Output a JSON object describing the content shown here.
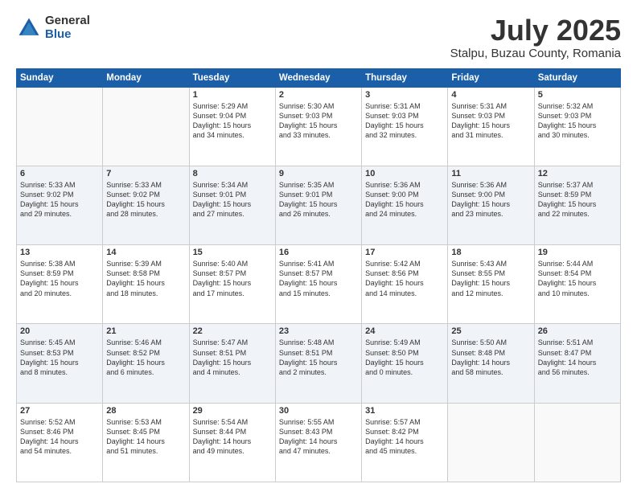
{
  "logo": {
    "general": "General",
    "blue": "Blue"
  },
  "title": "July 2025",
  "location": "Stalpu, Buzau County, Romania",
  "weekdays": [
    "Sunday",
    "Monday",
    "Tuesday",
    "Wednesday",
    "Thursday",
    "Friday",
    "Saturday"
  ],
  "weeks": [
    [
      {
        "day": "",
        "info": ""
      },
      {
        "day": "",
        "info": ""
      },
      {
        "day": "1",
        "info": "Sunrise: 5:29 AM\nSunset: 9:04 PM\nDaylight: 15 hours\nand 34 minutes."
      },
      {
        "day": "2",
        "info": "Sunrise: 5:30 AM\nSunset: 9:03 PM\nDaylight: 15 hours\nand 33 minutes."
      },
      {
        "day": "3",
        "info": "Sunrise: 5:31 AM\nSunset: 9:03 PM\nDaylight: 15 hours\nand 32 minutes."
      },
      {
        "day": "4",
        "info": "Sunrise: 5:31 AM\nSunset: 9:03 PM\nDaylight: 15 hours\nand 31 minutes."
      },
      {
        "day": "5",
        "info": "Sunrise: 5:32 AM\nSunset: 9:03 PM\nDaylight: 15 hours\nand 30 minutes."
      }
    ],
    [
      {
        "day": "6",
        "info": "Sunrise: 5:33 AM\nSunset: 9:02 PM\nDaylight: 15 hours\nand 29 minutes."
      },
      {
        "day": "7",
        "info": "Sunrise: 5:33 AM\nSunset: 9:02 PM\nDaylight: 15 hours\nand 28 minutes."
      },
      {
        "day": "8",
        "info": "Sunrise: 5:34 AM\nSunset: 9:01 PM\nDaylight: 15 hours\nand 27 minutes."
      },
      {
        "day": "9",
        "info": "Sunrise: 5:35 AM\nSunset: 9:01 PM\nDaylight: 15 hours\nand 26 minutes."
      },
      {
        "day": "10",
        "info": "Sunrise: 5:36 AM\nSunset: 9:00 PM\nDaylight: 15 hours\nand 24 minutes."
      },
      {
        "day": "11",
        "info": "Sunrise: 5:36 AM\nSunset: 9:00 PM\nDaylight: 15 hours\nand 23 minutes."
      },
      {
        "day": "12",
        "info": "Sunrise: 5:37 AM\nSunset: 8:59 PM\nDaylight: 15 hours\nand 22 minutes."
      }
    ],
    [
      {
        "day": "13",
        "info": "Sunrise: 5:38 AM\nSunset: 8:59 PM\nDaylight: 15 hours\nand 20 minutes."
      },
      {
        "day": "14",
        "info": "Sunrise: 5:39 AM\nSunset: 8:58 PM\nDaylight: 15 hours\nand 18 minutes."
      },
      {
        "day": "15",
        "info": "Sunrise: 5:40 AM\nSunset: 8:57 PM\nDaylight: 15 hours\nand 17 minutes."
      },
      {
        "day": "16",
        "info": "Sunrise: 5:41 AM\nSunset: 8:57 PM\nDaylight: 15 hours\nand 15 minutes."
      },
      {
        "day": "17",
        "info": "Sunrise: 5:42 AM\nSunset: 8:56 PM\nDaylight: 15 hours\nand 14 minutes."
      },
      {
        "day": "18",
        "info": "Sunrise: 5:43 AM\nSunset: 8:55 PM\nDaylight: 15 hours\nand 12 minutes."
      },
      {
        "day": "19",
        "info": "Sunrise: 5:44 AM\nSunset: 8:54 PM\nDaylight: 15 hours\nand 10 minutes."
      }
    ],
    [
      {
        "day": "20",
        "info": "Sunrise: 5:45 AM\nSunset: 8:53 PM\nDaylight: 15 hours\nand 8 minutes."
      },
      {
        "day": "21",
        "info": "Sunrise: 5:46 AM\nSunset: 8:52 PM\nDaylight: 15 hours\nand 6 minutes."
      },
      {
        "day": "22",
        "info": "Sunrise: 5:47 AM\nSunset: 8:51 PM\nDaylight: 15 hours\nand 4 minutes."
      },
      {
        "day": "23",
        "info": "Sunrise: 5:48 AM\nSunset: 8:51 PM\nDaylight: 15 hours\nand 2 minutes."
      },
      {
        "day": "24",
        "info": "Sunrise: 5:49 AM\nSunset: 8:50 PM\nDaylight: 15 hours\nand 0 minutes."
      },
      {
        "day": "25",
        "info": "Sunrise: 5:50 AM\nSunset: 8:48 PM\nDaylight: 14 hours\nand 58 minutes."
      },
      {
        "day": "26",
        "info": "Sunrise: 5:51 AM\nSunset: 8:47 PM\nDaylight: 14 hours\nand 56 minutes."
      }
    ],
    [
      {
        "day": "27",
        "info": "Sunrise: 5:52 AM\nSunset: 8:46 PM\nDaylight: 14 hours\nand 54 minutes."
      },
      {
        "day": "28",
        "info": "Sunrise: 5:53 AM\nSunset: 8:45 PM\nDaylight: 14 hours\nand 51 minutes."
      },
      {
        "day": "29",
        "info": "Sunrise: 5:54 AM\nSunset: 8:44 PM\nDaylight: 14 hours\nand 49 minutes."
      },
      {
        "day": "30",
        "info": "Sunrise: 5:55 AM\nSunset: 8:43 PM\nDaylight: 14 hours\nand 47 minutes."
      },
      {
        "day": "31",
        "info": "Sunrise: 5:57 AM\nSunset: 8:42 PM\nDaylight: 14 hours\nand 45 minutes."
      },
      {
        "day": "",
        "info": ""
      },
      {
        "day": "",
        "info": ""
      }
    ]
  ]
}
